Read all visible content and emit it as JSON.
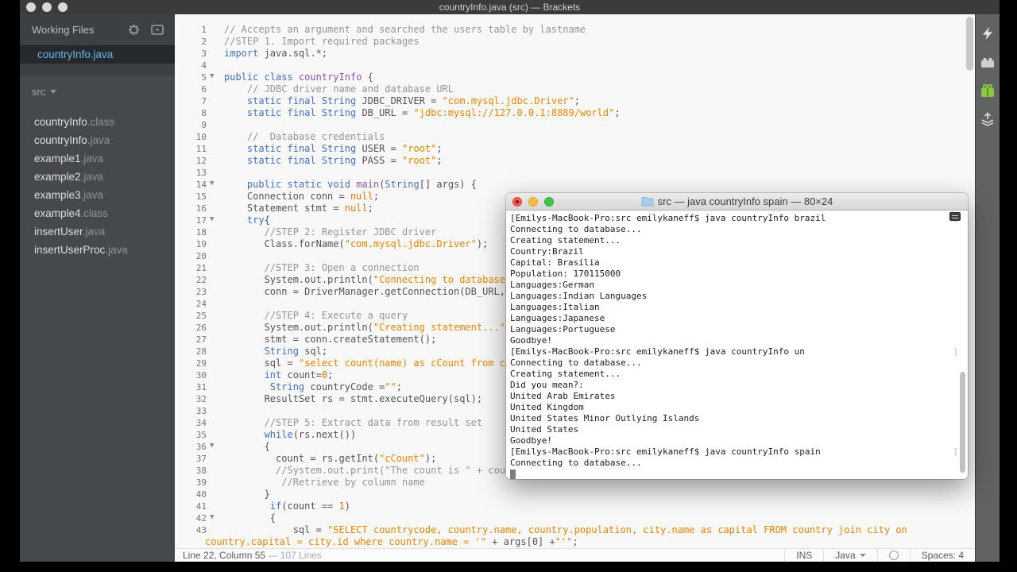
{
  "window": {
    "title": "countryInfo.java (src) — Brackets"
  },
  "sidebar": {
    "working_files_label": "Working Files",
    "selected_file": "countryInfo.java",
    "project_label": "src",
    "files": [
      {
        "base": "countryInfo",
        "ext": ".class"
      },
      {
        "base": "countryInfo",
        "ext": ".java"
      },
      {
        "base": "example1",
        "ext": ".java"
      },
      {
        "base": "example2",
        "ext": ".java"
      },
      {
        "base": "example3",
        "ext": ".java"
      },
      {
        "base": "example4",
        "ext": ".class"
      },
      {
        "base": "insertUser",
        "ext": ".java"
      },
      {
        "base": "insertUserProc",
        "ext": ".java"
      }
    ]
  },
  "editor": {
    "lines": [
      {
        "n": 1,
        "segs": [
          [
            "c",
            "// Accepts an argument and searched the users table by lastname"
          ]
        ]
      },
      {
        "n": 2,
        "segs": [
          [
            "c",
            "//STEP 1. Import required packages"
          ]
        ]
      },
      {
        "n": 3,
        "segs": [
          [
            "k",
            "import"
          ],
          [
            "v",
            " java.sql.*;"
          ]
        ]
      },
      {
        "n": 4,
        "segs": []
      },
      {
        "n": 5,
        "fold": true,
        "segs": [
          [
            "k",
            "public"
          ],
          [
            "v",
            " "
          ],
          [
            "k",
            "class"
          ],
          [
            "v",
            " "
          ],
          [
            "d",
            "countryInfo"
          ],
          [
            "v",
            " {"
          ]
        ]
      },
      {
        "n": 6,
        "segs": [
          [
            "v",
            "    "
          ],
          [
            "c",
            "// JDBC driver name and database URL"
          ]
        ]
      },
      {
        "n": 7,
        "segs": [
          [
            "v",
            "    "
          ],
          [
            "k",
            "static"
          ],
          [
            "v",
            " "
          ],
          [
            "k",
            "final"
          ],
          [
            "v",
            " "
          ],
          [
            "t",
            "String"
          ],
          [
            "v",
            " JDBC_DRIVER = "
          ],
          [
            "s",
            "\"com.mysql.jdbc.Driver\""
          ],
          [
            "v",
            ";"
          ]
        ]
      },
      {
        "n": 8,
        "segs": [
          [
            "v",
            "    "
          ],
          [
            "k",
            "static"
          ],
          [
            "v",
            " "
          ],
          [
            "k",
            "final"
          ],
          [
            "v",
            " "
          ],
          [
            "t",
            "String"
          ],
          [
            "v",
            " DB_URL = "
          ],
          [
            "s",
            "\"jdbc:mysql://127.0.0.1:8889/world\""
          ],
          [
            "v",
            ";"
          ]
        ]
      },
      {
        "n": 9,
        "segs": []
      },
      {
        "n": 10,
        "segs": [
          [
            "v",
            "    "
          ],
          [
            "c",
            "//  Database credentials"
          ]
        ]
      },
      {
        "n": 11,
        "segs": [
          [
            "v",
            "    "
          ],
          [
            "k",
            "static"
          ],
          [
            "v",
            " "
          ],
          [
            "k",
            "final"
          ],
          [
            "v",
            " "
          ],
          [
            "t",
            "String"
          ],
          [
            "v",
            " USER = "
          ],
          [
            "s",
            "\"root\""
          ],
          [
            "v",
            ";"
          ]
        ]
      },
      {
        "n": 12,
        "segs": [
          [
            "v",
            "    "
          ],
          [
            "k",
            "static"
          ],
          [
            "v",
            " "
          ],
          [
            "k",
            "final"
          ],
          [
            "v",
            " "
          ],
          [
            "t",
            "String"
          ],
          [
            "v",
            " PASS = "
          ],
          [
            "s",
            "\"root\""
          ],
          [
            "v",
            ";"
          ]
        ]
      },
      {
        "n": 13,
        "segs": []
      },
      {
        "n": 14,
        "fold": true,
        "segs": [
          [
            "v",
            "    "
          ],
          [
            "k",
            "public"
          ],
          [
            "v",
            " "
          ],
          [
            "k",
            "static"
          ],
          [
            "v",
            " "
          ],
          [
            "k",
            "void"
          ],
          [
            "v",
            " "
          ],
          [
            "d",
            "main"
          ],
          [
            "v",
            "("
          ],
          [
            "t",
            "String"
          ],
          [
            "v",
            "[] args) {"
          ]
        ]
      },
      {
        "n": 15,
        "segs": [
          [
            "v",
            "    Connection conn = "
          ],
          [
            "a",
            "null"
          ],
          [
            "v",
            ";"
          ]
        ]
      },
      {
        "n": 16,
        "segs": [
          [
            "v",
            "    Statement stmt = "
          ],
          [
            "a",
            "null"
          ],
          [
            "v",
            ";"
          ]
        ]
      },
      {
        "n": 17,
        "fold": true,
        "segs": [
          [
            "v",
            "    "
          ],
          [
            "k",
            "try"
          ],
          [
            "v",
            "{"
          ]
        ]
      },
      {
        "n": 18,
        "segs": [
          [
            "v",
            "       "
          ],
          [
            "c",
            "//STEP 2: Register JDBC driver"
          ]
        ]
      },
      {
        "n": 19,
        "segs": [
          [
            "v",
            "       Class.forName("
          ],
          [
            "s",
            "\"com.mysql.jdbc.Driver\""
          ],
          [
            "v",
            ");"
          ]
        ]
      },
      {
        "n": 20,
        "segs": []
      },
      {
        "n": 21,
        "segs": [
          [
            "v",
            "       "
          ],
          [
            "c",
            "//STEP 3: Open a connection"
          ]
        ]
      },
      {
        "n": 22,
        "segs": [
          [
            "v",
            "       System.out.println("
          ],
          [
            "s",
            "\"Connecting to database..."
          ]
        ]
      },
      {
        "n": 23,
        "segs": [
          [
            "v",
            "       conn = DriverManager.getConnection(DB_URL,USE"
          ]
        ]
      },
      {
        "n": 24,
        "segs": []
      },
      {
        "n": 25,
        "segs": [
          [
            "v",
            "       "
          ],
          [
            "c",
            "//STEP 4: Execute a query"
          ]
        ]
      },
      {
        "n": 26,
        "segs": [
          [
            "v",
            "       System.out.println("
          ],
          [
            "s",
            "\"Creating statement...\""
          ],
          [
            "v",
            ");"
          ]
        ]
      },
      {
        "n": 27,
        "segs": [
          [
            "v",
            "       stmt = conn.createStatement();"
          ]
        ]
      },
      {
        "n": 28,
        "segs": [
          [
            "v",
            "       "
          ],
          [
            "t",
            "String"
          ],
          [
            "v",
            " sql;"
          ]
        ]
      },
      {
        "n": 29,
        "segs": [
          [
            "v",
            "       sql = "
          ],
          [
            "s",
            "\"select count(name) as cCount from coun"
          ]
        ]
      },
      {
        "n": 30,
        "segs": [
          [
            "v",
            "       "
          ],
          [
            "k",
            "int"
          ],
          [
            "v",
            " count="
          ],
          [
            "a",
            "0"
          ],
          [
            "v",
            ";"
          ]
        ]
      },
      {
        "n": 31,
        "segs": [
          [
            "v",
            "        "
          ],
          [
            "t",
            "String"
          ],
          [
            "v",
            " countryCode ="
          ],
          [
            "s",
            "\"\""
          ],
          [
            "v",
            ";"
          ]
        ]
      },
      {
        "n": 32,
        "segs": [
          [
            "v",
            "       ResultSet rs = stmt.executeQuery(sql);"
          ]
        ]
      },
      {
        "n": 33,
        "segs": []
      },
      {
        "n": 34,
        "segs": [
          [
            "v",
            "       "
          ],
          [
            "c",
            "//STEP 5: Extract data from result set"
          ]
        ]
      },
      {
        "n": 35,
        "segs": [
          [
            "v",
            "       "
          ],
          [
            "k",
            "while"
          ],
          [
            "v",
            "(rs.next())"
          ]
        ]
      },
      {
        "n": 36,
        "fold": true,
        "segs": [
          [
            "v",
            "       {"
          ]
        ]
      },
      {
        "n": 37,
        "segs": [
          [
            "v",
            "         count = rs.getInt("
          ],
          [
            "s",
            "\"cCount\""
          ],
          [
            "v",
            ");"
          ]
        ]
      },
      {
        "n": 38,
        "segs": [
          [
            "v",
            "         "
          ],
          [
            "c",
            "//System.out.print(\"The count is \" + count)"
          ]
        ]
      },
      {
        "n": 39,
        "segs": [
          [
            "v",
            "          "
          ],
          [
            "c",
            "//Retrieve by column name"
          ]
        ]
      },
      {
        "n": 40,
        "segs": [
          [
            "v",
            "       }"
          ]
        ]
      },
      {
        "n": 41,
        "segs": [
          [
            "v",
            "        "
          ],
          [
            "k",
            "if"
          ],
          [
            "v",
            "(count == "
          ],
          [
            "a",
            "1"
          ],
          [
            "v",
            ")"
          ]
        ]
      },
      {
        "n": 42,
        "fold": true,
        "segs": [
          [
            "v",
            "        {"
          ]
        ]
      },
      {
        "n": 43,
        "segs": [
          [
            "v",
            "            sql = "
          ],
          [
            "s",
            "\"SELECT countrycode, country.name, country.population, city.name as capital FROM country join city on"
          ]
        ]
      },
      {
        "n": "",
        "wrap": true,
        "segs": [
          [
            "s",
            "country.capital = city.id where country.name = '\""
          ],
          [
            "v",
            " + args[0] +"
          ],
          [
            "s",
            "\"'\""
          ],
          [
            "v",
            ";"
          ]
        ]
      }
    ]
  },
  "terminal": {
    "title": "src — java countryInfo spain — 80×24",
    "lines": [
      {
        "text": "[Emilys-MacBook-Pro:src emilykaneff$ java countryInfo brazil",
        "mark": true
      },
      {
        "text": "Connecting to database..."
      },
      {
        "text": "Creating statement..."
      },
      {
        "text": "Country:Brazil"
      },
      {
        "text": "Capital: Brasília"
      },
      {
        "text": "Population: 170115000"
      },
      {
        "text": "Languages:German"
      },
      {
        "text": "Languages:Indian Languages"
      },
      {
        "text": "Languages:Italian"
      },
      {
        "text": "Languages:Japanese"
      },
      {
        "text": "Languages:Portuguese"
      },
      {
        "text": "Goodbye!"
      },
      {
        "text": "[Emilys-MacBook-Pro:src emilykaneff$ java countryInfo un",
        "mark": true
      },
      {
        "text": "Connecting to database..."
      },
      {
        "text": "Creating statement..."
      },
      {
        "text": "Did you mean?:"
      },
      {
        "text": "United Arab Emirates"
      },
      {
        "text": "United Kingdom"
      },
      {
        "text": "United States Minor Outlying Islands"
      },
      {
        "text": "United States"
      },
      {
        "text": "Goodbye!"
      },
      {
        "text": "[Emilys-MacBook-Pro:src emilykaneff$ java countryInfo spain",
        "mark": true
      },
      {
        "text": "Connecting to database..."
      },
      {
        "text": "",
        "cursor": true
      }
    ]
  },
  "statusbar": {
    "cursor_pos": "Line 22, Column 55",
    "lines_info": "— 107 Lines",
    "insert_mode": "INS",
    "language": "Java",
    "spaces": "Spaces: 4"
  },
  "colors": {
    "accent_blue": "#6cb5ea",
    "keyword": "#446fbd",
    "string": "#e88501",
    "comment": "#949494",
    "gift_green": "#8dc63f"
  }
}
